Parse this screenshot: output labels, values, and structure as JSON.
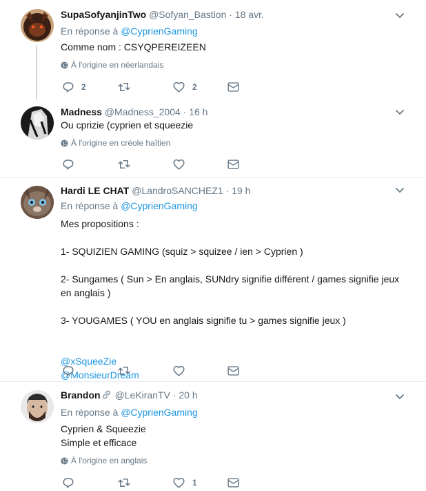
{
  "tweets": [
    {
      "name": "SupaSofyanjinTwo",
      "handle": "@Sofyan_Bastion",
      "dot": "·",
      "time": "18 avr.",
      "reply_prefix": "En réponse à",
      "reply_to": "@CyprienGaming",
      "text": "Comme nom : CSYQPEREIZEEN",
      "translated": "À l'origine en néerlandais",
      "reply_count": "2",
      "retweet_count": "",
      "like_count": "2"
    },
    {
      "name": "Madness",
      "handle": "@Madness_2004",
      "dot": "·",
      "time": "16 h",
      "text": "Ou cprizie (cyprien et squeezie",
      "translated": "À l'origine en créole haïtien",
      "reply_count": "",
      "retweet_count": "",
      "like_count": ""
    },
    {
      "name": "Hardi LE CHAT",
      "handle": "@LandroSANCHEZ1",
      "dot": "·",
      "time": "19 h",
      "reply_prefix": "En réponse à",
      "reply_to": "@CyprienGaming",
      "text": "Mes propositions :\n\n1- SQUIZIEN GAMING (squiz > squizee / ien > Cyprien )\n\n2- Sungames    ( Sun > En anglais, SUNdry signifie différent /  games signifie jeux en anglais )\n\n3- YOUGAMES ( YOU en anglais signifie tu > games signifie jeux )",
      "mention_1": "@xSqueeZie",
      "mention_2": "@MonsieurDream",
      "reply_count": "",
      "retweet_count": "",
      "like_count": ""
    },
    {
      "name": "Brandon",
      "handle": "@LeKiranTV",
      "dot": "·",
      "time": "20 h",
      "reply_prefix": "En réponse à",
      "reply_to": "@CyprienGaming",
      "text": "Cyprien & Squeezie\nSimple et efficace",
      "translated": "À l'origine en anglais",
      "reply_count": "",
      "retweet_count": "",
      "like_count": "1"
    }
  ],
  "colors": {
    "link": "#1b95e0",
    "muted": "#657786",
    "text": "#14171a",
    "separator": "#e6ecf0",
    "thread_line": "#ccd6dd"
  },
  "icons": {
    "menu": "chevron-down-icon",
    "reply": "reply-icon",
    "retweet": "retweet-icon",
    "like": "heart-icon",
    "dm": "envelope-icon",
    "translate": "globe-icon",
    "link": "link-icon"
  }
}
